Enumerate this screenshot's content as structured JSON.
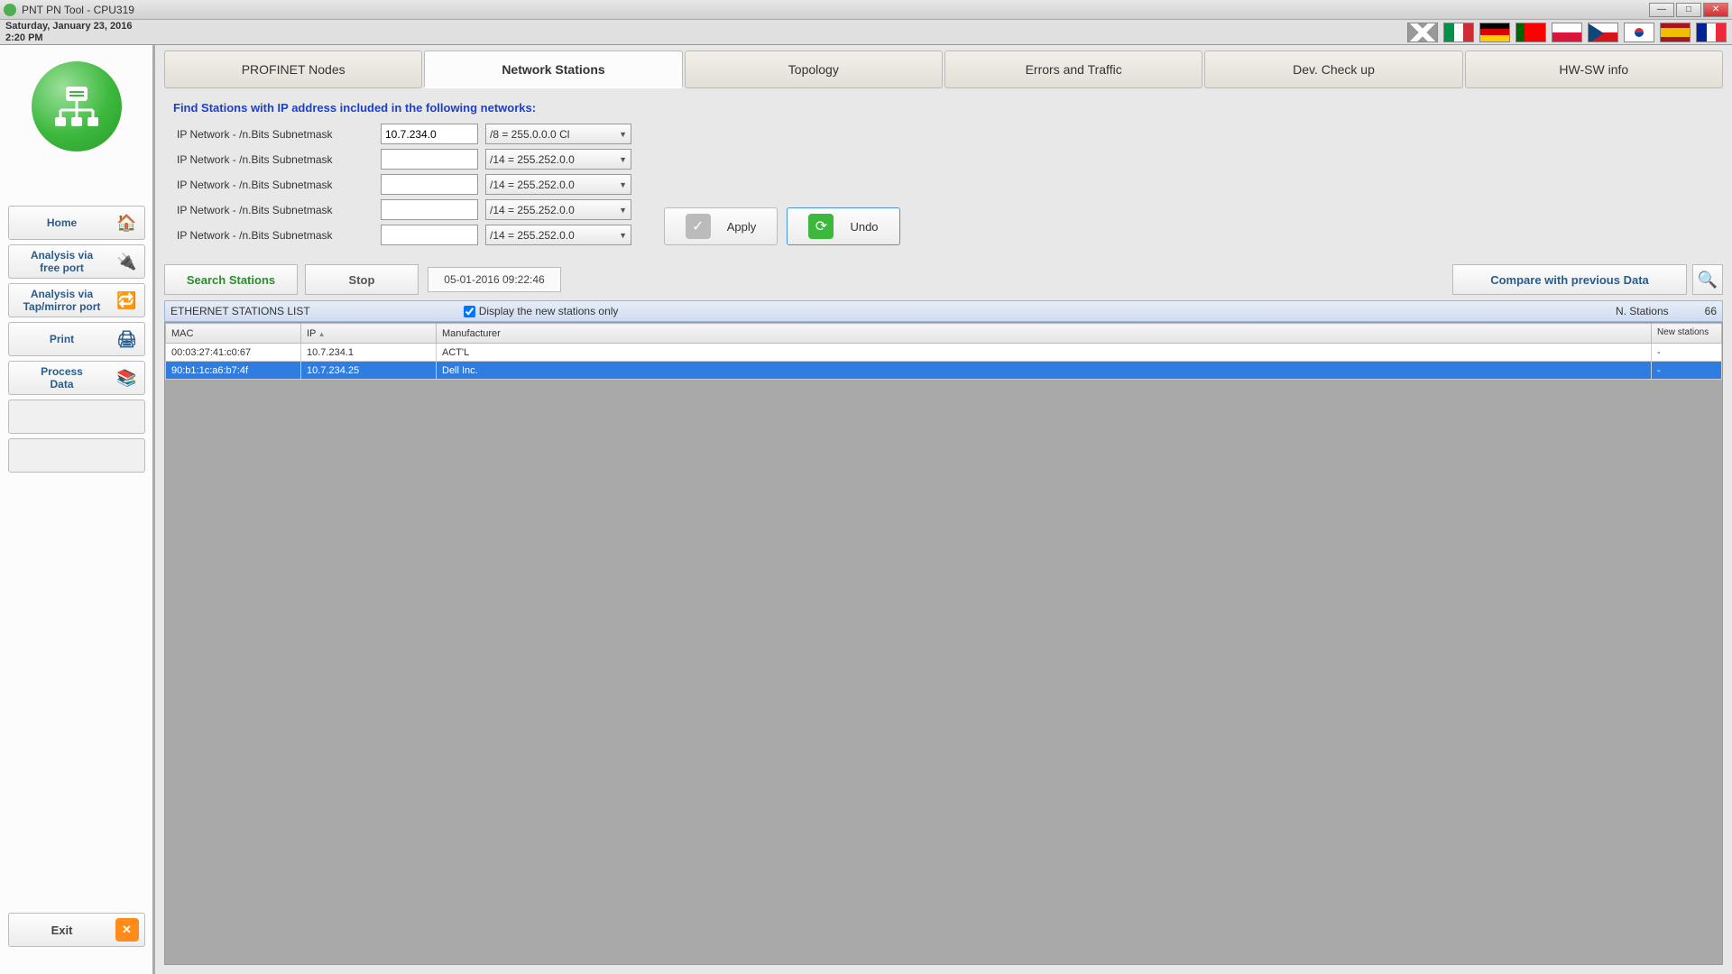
{
  "window": {
    "title": "PNT PN Tool - CPU319"
  },
  "datetime": {
    "date": "Saturday, January 23, 2016",
    "time": "2:20 PM"
  },
  "flags": [
    "uk",
    "it",
    "de",
    "pt",
    "pl",
    "cz",
    "kr",
    "es",
    "fr"
  ],
  "sidebar": {
    "buttons": [
      {
        "label": "Home",
        "icon": "🏠"
      },
      {
        "label": "Analysis via\nfree port",
        "icon": "🔌"
      },
      {
        "label": "Analysis via\nTap/mirror port",
        "icon": "🔁"
      },
      {
        "label": "Print",
        "icon": "🖨"
      },
      {
        "label": "Process\nData",
        "icon": "📚"
      }
    ],
    "exit": "Exit"
  },
  "tabs": [
    "PROFINET Nodes",
    "Network Stations",
    "Topology",
    "Errors and Traffic",
    "Dev. Check up",
    "HW-SW info"
  ],
  "active_tab": 1,
  "form": {
    "heading": "Find Stations with IP address included in the following networks:",
    "row_label": "IP Network - /n.Bits Subnetmask",
    "rows": [
      {
        "ip": "10.7.234.0",
        "mask": "/8   = 255.0.0.0       Cl"
      },
      {
        "ip": "",
        "mask": "/14 = 255.252.0.0"
      },
      {
        "ip": "",
        "mask": "/14 = 255.252.0.0"
      },
      {
        "ip": "",
        "mask": "/14 = 255.252.0.0"
      },
      {
        "ip": "",
        "mask": "/14 = 255.252.0.0"
      }
    ],
    "apply": "Apply",
    "undo": "Undo"
  },
  "search_stations": "Search Stations",
  "stop": "Stop",
  "timestamp": "05-01-2016   09:22:46",
  "compare": "Compare with previous Data",
  "list": {
    "title": "ETHERNET STATIONS LIST",
    "checkbox_label": "Display the new stations only",
    "nstations_label": "N. Stations",
    "count": "66",
    "columns": {
      "mac": "MAC",
      "ip": "IP",
      "mfr": "Manufacturer",
      "new": "New stations"
    },
    "rows": [
      {
        "mac": "00:03:27:41:c0:67",
        "ip": "10.7.234.1",
        "mfr": "ACT'L",
        "new": "-"
      },
      {
        "mac": "90:b1:1c:a6:b7:4f",
        "ip": "10.7.234.25",
        "mfr": "Dell Inc.",
        "new": "-"
      }
    ],
    "selected": 1
  }
}
